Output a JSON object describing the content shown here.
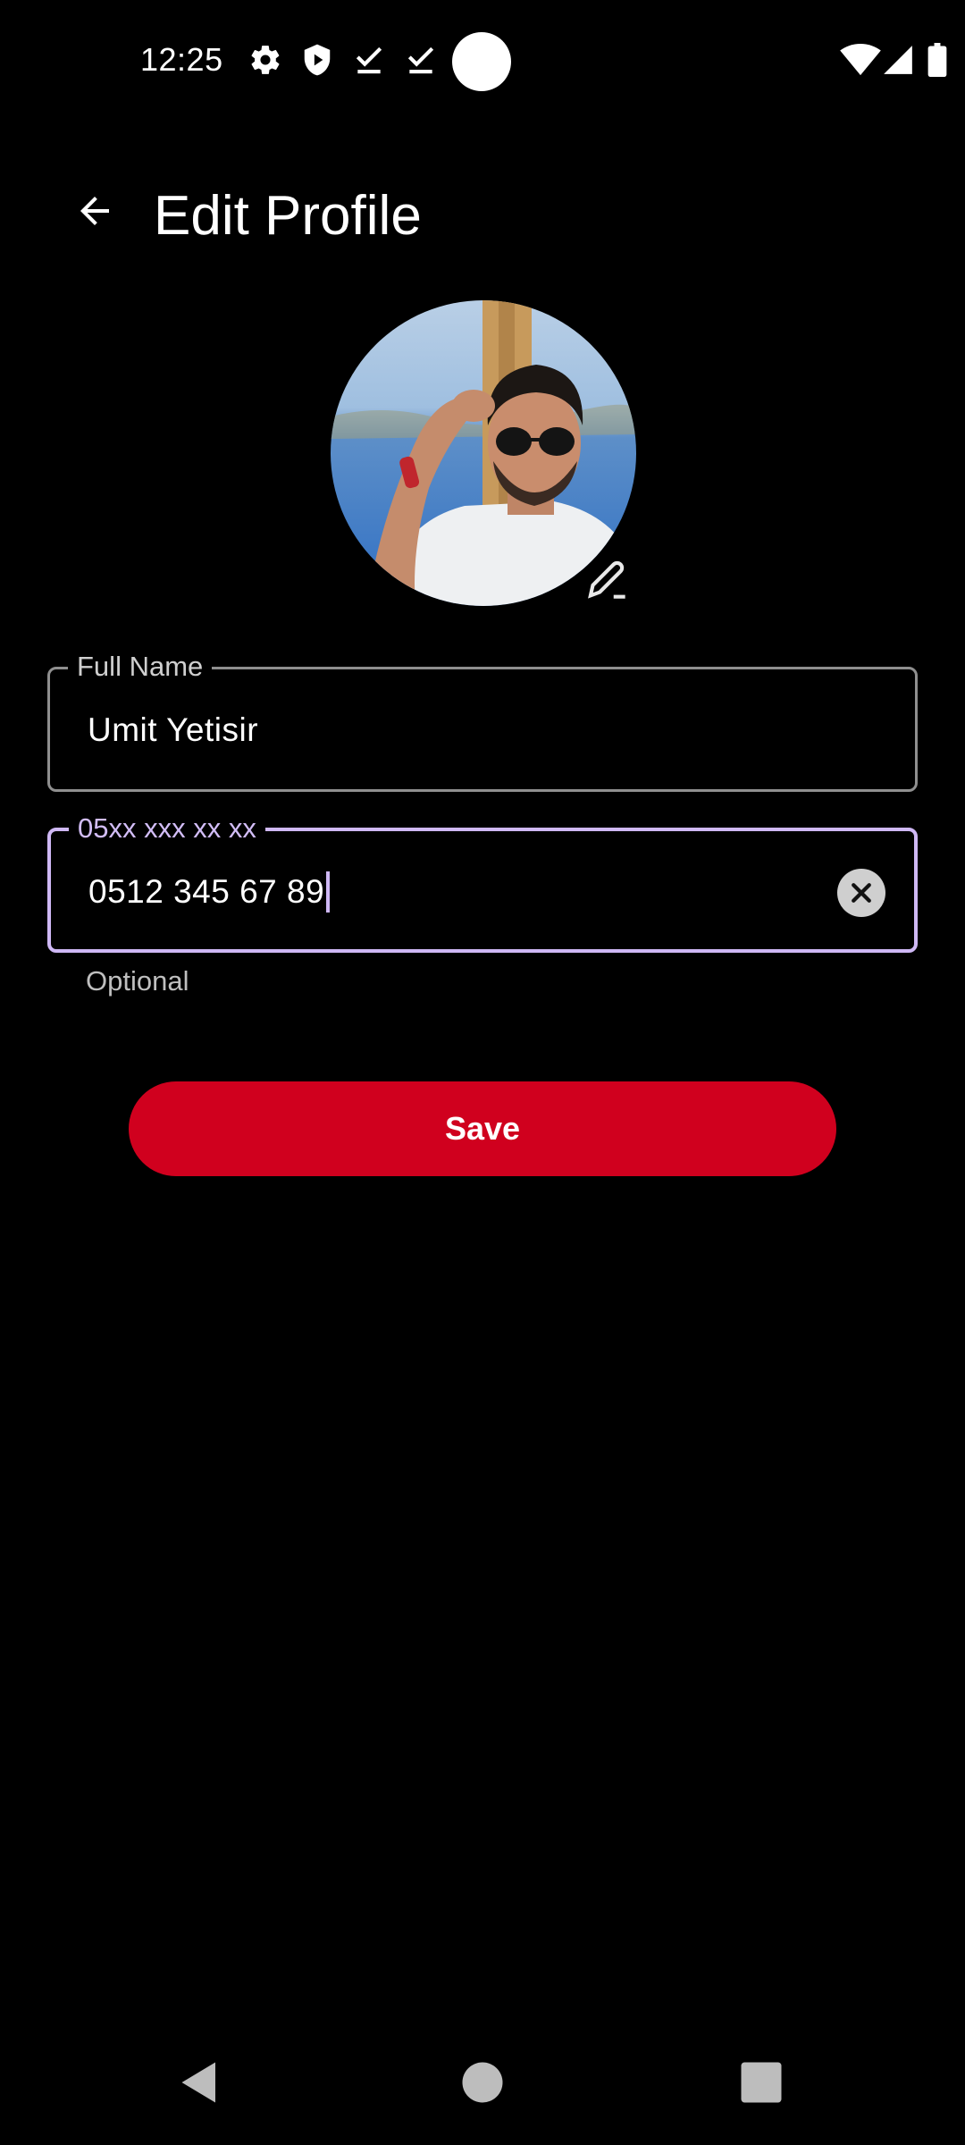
{
  "status_bar": {
    "time": "12:25",
    "left_icons": [
      "settings-icon",
      "shield-icon",
      "download-done-icon",
      "download-done-icon"
    ],
    "right_icons": [
      "wifi-icon",
      "cellular-signal-icon",
      "battery-icon"
    ]
  },
  "app_bar": {
    "title": "Edit Profile",
    "back_icon": "arrow-back-icon"
  },
  "profile": {
    "avatar_edit_icon": "edit-pencil-icon"
  },
  "form": {
    "full_name": {
      "label": "Full Name",
      "value": "Umit Yetisir"
    },
    "phone": {
      "label": "05xx xxx xx xx",
      "value": "0512 345 67 89",
      "helper": "Optional",
      "clear_icon": "clear-icon"
    },
    "save_label": "Save"
  },
  "nav_bar": {
    "icons": [
      "nav-back-icon",
      "nav-home-icon",
      "nav-recents-icon"
    ]
  },
  "colors": {
    "background": "#000000",
    "accent": "#cfb8f5",
    "save_button": "#d0001e"
  }
}
